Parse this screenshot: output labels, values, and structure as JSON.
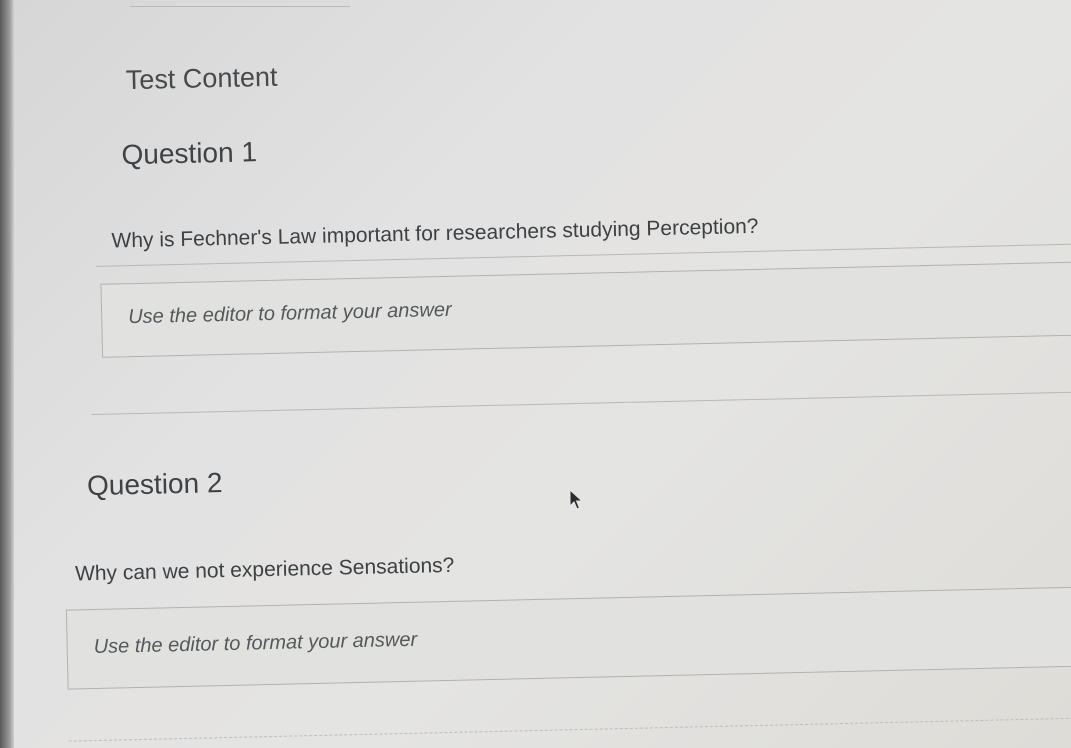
{
  "test": {
    "section_title": "Test Content",
    "questions": [
      {
        "title": "Question 1",
        "text": "Why is Fechner's Law important for researchers studying Perception?",
        "answer_placeholder": "Use the editor to format your answer"
      },
      {
        "title": "Question 2",
        "text": "Why can we not experience Sensations?",
        "answer_placeholder": "Use the editor to format your answer"
      }
    ]
  }
}
